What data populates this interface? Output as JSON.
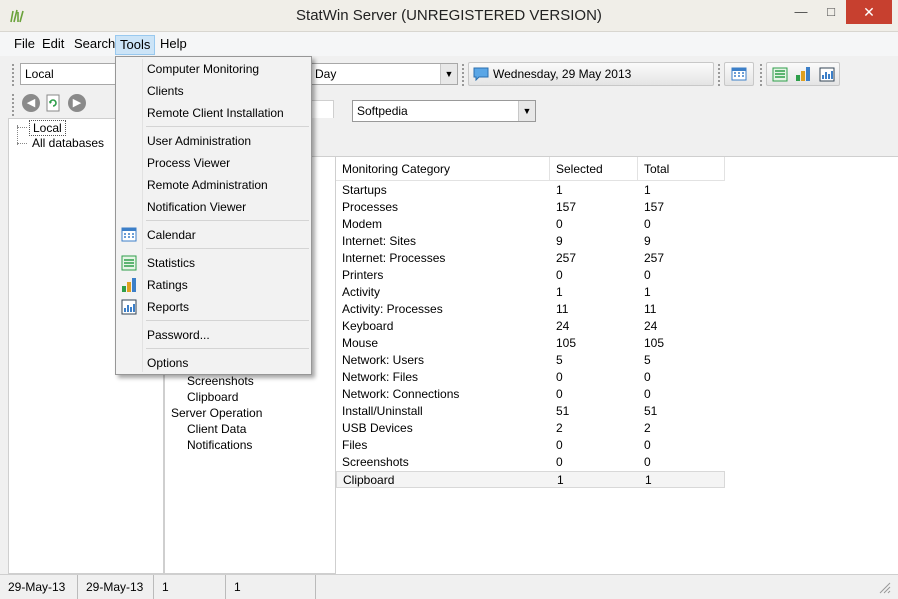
{
  "window": {
    "title": "StatWin Server (UNREGISTERED VERSION)"
  },
  "menubar": [
    {
      "label": "File"
    },
    {
      "label": "Edit"
    },
    {
      "label": "Search"
    },
    {
      "label": "Tools"
    },
    {
      "label": "Help"
    }
  ],
  "toolbar": {
    "location_combo": "Local",
    "period_combo": "Day",
    "date_label": "Wednesday, 29 May 2013"
  },
  "tree": {
    "items": [
      "Local",
      "All databases"
    ]
  },
  "filter_combo": "Softpedia",
  "middle_list": [
    "Screenshots",
    "Clipboard",
    "Server Operation",
    "Client Data",
    "Notifications"
  ],
  "tools_menu": [
    {
      "label": "Computer Monitoring",
      "icon": ""
    },
    {
      "label": "Clients",
      "icon": ""
    },
    {
      "label": "Remote Client Installation",
      "icon": ""
    },
    {
      "sep": true
    },
    {
      "label": "User Administration",
      "icon": ""
    },
    {
      "label": "Process Viewer",
      "icon": ""
    },
    {
      "label": "Remote Administration",
      "icon": ""
    },
    {
      "label": "Notification Viewer",
      "icon": ""
    },
    {
      "sep": true
    },
    {
      "label": "Calendar",
      "icon": "calendar-icon"
    },
    {
      "sep": true
    },
    {
      "label": "Statistics",
      "icon": "statistics-icon"
    },
    {
      "label": "Ratings",
      "icon": "ratings-icon"
    },
    {
      "label": "Reports",
      "icon": "reports-icon"
    },
    {
      "sep": true
    },
    {
      "label": "Password...",
      "icon": ""
    },
    {
      "sep": true
    },
    {
      "label": "Options",
      "icon": ""
    }
  ],
  "table": {
    "columns": [
      "Monitoring Category",
      "Selected",
      "Total"
    ],
    "rows": [
      [
        "Startups",
        "1",
        "1"
      ],
      [
        "Processes",
        "157",
        "157"
      ],
      [
        "Modem",
        "0",
        "0"
      ],
      [
        "Internet: Sites",
        "9",
        "9"
      ],
      [
        "Internet: Processes",
        "257",
        "257"
      ],
      [
        "Printers",
        "0",
        "0"
      ],
      [
        "Activity",
        "1",
        "1"
      ],
      [
        "Activity: Processes",
        "11",
        "11"
      ],
      [
        "Keyboard",
        "24",
        "24"
      ],
      [
        "Mouse",
        "105",
        "105"
      ],
      [
        "Network: Users",
        "5",
        "5"
      ],
      [
        "Network: Files",
        "0",
        "0"
      ],
      [
        "Network: Connections",
        "0",
        "0"
      ],
      [
        "Install/Uninstall",
        "51",
        "51"
      ],
      [
        "USB Devices",
        "2",
        "2"
      ],
      [
        "Files",
        "0",
        "0"
      ],
      [
        "Screenshots",
        "0",
        "0"
      ],
      [
        "Clipboard",
        "1",
        "1"
      ]
    ],
    "selected_row": 17
  },
  "statusbar": [
    "29-May-13",
    "29-May-13",
    "1",
    "1"
  ],
  "colors": {
    "menu_highlight": "#cce4f7",
    "close_button": "#c7402f",
    "calendar_blue": "#3c7fc8",
    "stats_green": "#2e9e4a"
  }
}
